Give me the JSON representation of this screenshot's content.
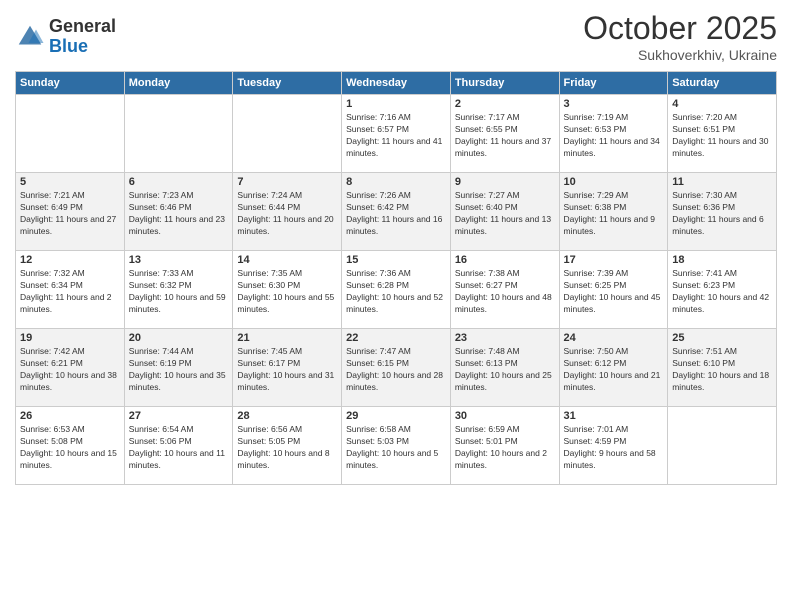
{
  "logo": {
    "general": "General",
    "blue": "Blue"
  },
  "header": {
    "month": "October 2025",
    "location": "Sukhoverkhiv, Ukraine"
  },
  "weekdays": [
    "Sunday",
    "Monday",
    "Tuesday",
    "Wednesday",
    "Thursday",
    "Friday",
    "Saturday"
  ],
  "weeks": [
    [
      {
        "day": "",
        "sunrise": "",
        "sunset": "",
        "daylight": ""
      },
      {
        "day": "",
        "sunrise": "",
        "sunset": "",
        "daylight": ""
      },
      {
        "day": "",
        "sunrise": "",
        "sunset": "",
        "daylight": ""
      },
      {
        "day": "1",
        "sunrise": "Sunrise: 7:16 AM",
        "sunset": "Sunset: 6:57 PM",
        "daylight": "Daylight: 11 hours and 41 minutes."
      },
      {
        "day": "2",
        "sunrise": "Sunrise: 7:17 AM",
        "sunset": "Sunset: 6:55 PM",
        "daylight": "Daylight: 11 hours and 37 minutes."
      },
      {
        "day": "3",
        "sunrise": "Sunrise: 7:19 AM",
        "sunset": "Sunset: 6:53 PM",
        "daylight": "Daylight: 11 hours and 34 minutes."
      },
      {
        "day": "4",
        "sunrise": "Sunrise: 7:20 AM",
        "sunset": "Sunset: 6:51 PM",
        "daylight": "Daylight: 11 hours and 30 minutes."
      }
    ],
    [
      {
        "day": "5",
        "sunrise": "Sunrise: 7:21 AM",
        "sunset": "Sunset: 6:49 PM",
        "daylight": "Daylight: 11 hours and 27 minutes."
      },
      {
        "day": "6",
        "sunrise": "Sunrise: 7:23 AM",
        "sunset": "Sunset: 6:46 PM",
        "daylight": "Daylight: 11 hours and 23 minutes."
      },
      {
        "day": "7",
        "sunrise": "Sunrise: 7:24 AM",
        "sunset": "Sunset: 6:44 PM",
        "daylight": "Daylight: 11 hours and 20 minutes."
      },
      {
        "day": "8",
        "sunrise": "Sunrise: 7:26 AM",
        "sunset": "Sunset: 6:42 PM",
        "daylight": "Daylight: 11 hours and 16 minutes."
      },
      {
        "day": "9",
        "sunrise": "Sunrise: 7:27 AM",
        "sunset": "Sunset: 6:40 PM",
        "daylight": "Daylight: 11 hours and 13 minutes."
      },
      {
        "day": "10",
        "sunrise": "Sunrise: 7:29 AM",
        "sunset": "Sunset: 6:38 PM",
        "daylight": "Daylight: 11 hours and 9 minutes."
      },
      {
        "day": "11",
        "sunrise": "Sunrise: 7:30 AM",
        "sunset": "Sunset: 6:36 PM",
        "daylight": "Daylight: 11 hours and 6 minutes."
      }
    ],
    [
      {
        "day": "12",
        "sunrise": "Sunrise: 7:32 AM",
        "sunset": "Sunset: 6:34 PM",
        "daylight": "Daylight: 11 hours and 2 minutes."
      },
      {
        "day": "13",
        "sunrise": "Sunrise: 7:33 AM",
        "sunset": "Sunset: 6:32 PM",
        "daylight": "Daylight: 10 hours and 59 minutes."
      },
      {
        "day": "14",
        "sunrise": "Sunrise: 7:35 AM",
        "sunset": "Sunset: 6:30 PM",
        "daylight": "Daylight: 10 hours and 55 minutes."
      },
      {
        "day": "15",
        "sunrise": "Sunrise: 7:36 AM",
        "sunset": "Sunset: 6:28 PM",
        "daylight": "Daylight: 10 hours and 52 minutes."
      },
      {
        "day": "16",
        "sunrise": "Sunrise: 7:38 AM",
        "sunset": "Sunset: 6:27 PM",
        "daylight": "Daylight: 10 hours and 48 minutes."
      },
      {
        "day": "17",
        "sunrise": "Sunrise: 7:39 AM",
        "sunset": "Sunset: 6:25 PM",
        "daylight": "Daylight: 10 hours and 45 minutes."
      },
      {
        "day": "18",
        "sunrise": "Sunrise: 7:41 AM",
        "sunset": "Sunset: 6:23 PM",
        "daylight": "Daylight: 10 hours and 42 minutes."
      }
    ],
    [
      {
        "day": "19",
        "sunrise": "Sunrise: 7:42 AM",
        "sunset": "Sunset: 6:21 PM",
        "daylight": "Daylight: 10 hours and 38 minutes."
      },
      {
        "day": "20",
        "sunrise": "Sunrise: 7:44 AM",
        "sunset": "Sunset: 6:19 PM",
        "daylight": "Daylight: 10 hours and 35 minutes."
      },
      {
        "day": "21",
        "sunrise": "Sunrise: 7:45 AM",
        "sunset": "Sunset: 6:17 PM",
        "daylight": "Daylight: 10 hours and 31 minutes."
      },
      {
        "day": "22",
        "sunrise": "Sunrise: 7:47 AM",
        "sunset": "Sunset: 6:15 PM",
        "daylight": "Daylight: 10 hours and 28 minutes."
      },
      {
        "day": "23",
        "sunrise": "Sunrise: 7:48 AM",
        "sunset": "Sunset: 6:13 PM",
        "daylight": "Daylight: 10 hours and 25 minutes."
      },
      {
        "day": "24",
        "sunrise": "Sunrise: 7:50 AM",
        "sunset": "Sunset: 6:12 PM",
        "daylight": "Daylight: 10 hours and 21 minutes."
      },
      {
        "day": "25",
        "sunrise": "Sunrise: 7:51 AM",
        "sunset": "Sunset: 6:10 PM",
        "daylight": "Daylight: 10 hours and 18 minutes."
      }
    ],
    [
      {
        "day": "26",
        "sunrise": "Sunrise: 6:53 AM",
        "sunset": "Sunset: 5:08 PM",
        "daylight": "Daylight: 10 hours and 15 minutes."
      },
      {
        "day": "27",
        "sunrise": "Sunrise: 6:54 AM",
        "sunset": "Sunset: 5:06 PM",
        "daylight": "Daylight: 10 hours and 11 minutes."
      },
      {
        "day": "28",
        "sunrise": "Sunrise: 6:56 AM",
        "sunset": "Sunset: 5:05 PM",
        "daylight": "Daylight: 10 hours and 8 minutes."
      },
      {
        "day": "29",
        "sunrise": "Sunrise: 6:58 AM",
        "sunset": "Sunset: 5:03 PM",
        "daylight": "Daylight: 10 hours and 5 minutes."
      },
      {
        "day": "30",
        "sunrise": "Sunrise: 6:59 AM",
        "sunset": "Sunset: 5:01 PM",
        "daylight": "Daylight: 10 hours and 2 minutes."
      },
      {
        "day": "31",
        "sunrise": "Sunrise: 7:01 AM",
        "sunset": "Sunset: 4:59 PM",
        "daylight": "Daylight: 9 hours and 58 minutes."
      },
      {
        "day": "",
        "sunrise": "",
        "sunset": "",
        "daylight": ""
      }
    ]
  ]
}
